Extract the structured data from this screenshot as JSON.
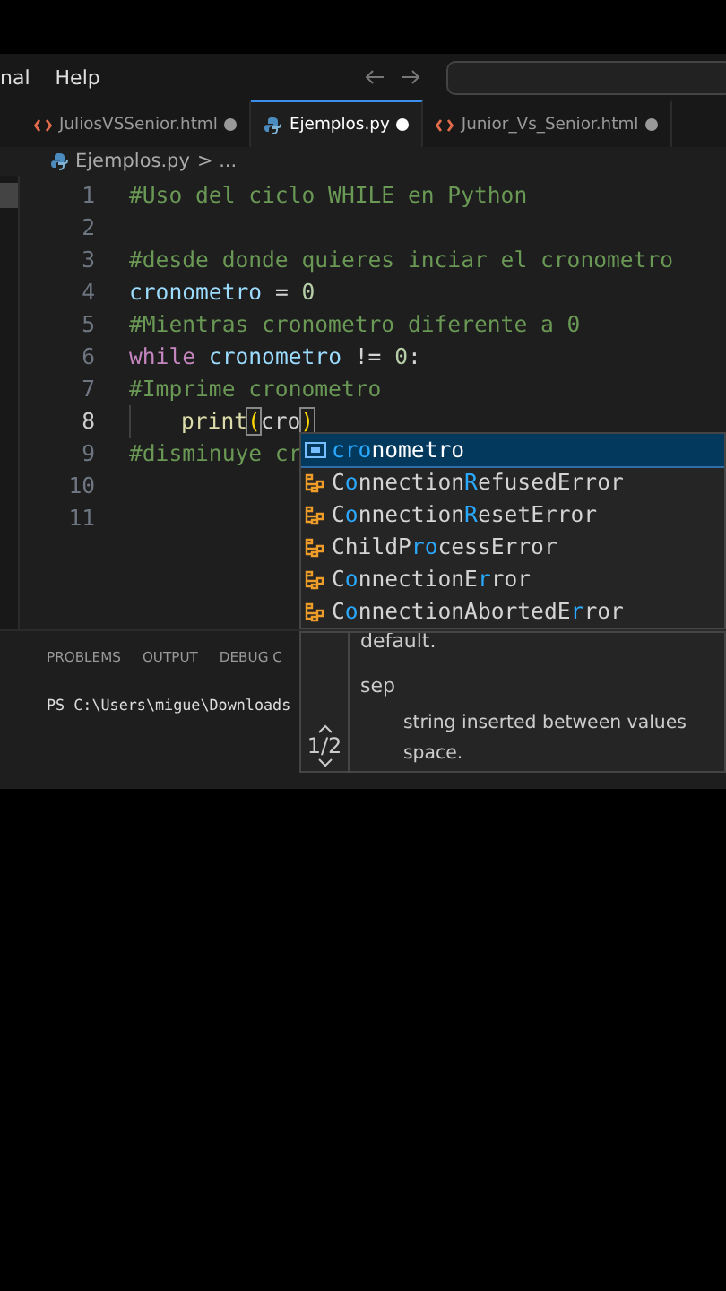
{
  "menu": [
    "nal",
    "Help"
  ],
  "tabs": [
    {
      "label": "JuliosVSSenior.html",
      "kind": "html",
      "selected": false,
      "modified": true
    },
    {
      "label": "Ejemplos.py",
      "kind": "python",
      "selected": true,
      "modified": true
    },
    {
      "label": "Junior_Vs_Senior.html",
      "kind": "html",
      "selected": false,
      "modified": true
    }
  ],
  "breadcrumb": {
    "file": "Ejemplos.py",
    "rest": "> ..."
  },
  "code": [
    {
      "number": "1",
      "current": false,
      "indent": false,
      "tokens": [
        {
          "kind": "comment",
          "text": "#Uso del ciclo WHILE en Python"
        }
      ]
    },
    {
      "number": "2",
      "current": false,
      "indent": false
    },
    {
      "number": "3",
      "current": false,
      "indent": false,
      "tokens": [
        {
          "kind": "comment",
          "text": "#desde donde quieres inciar el cronometro"
        }
      ]
    },
    {
      "number": "4",
      "current": false,
      "indent": false,
      "tokens": [
        {
          "kind": "variable",
          "text": "cronometro"
        },
        {
          "kind": "plain",
          "text": " = "
        },
        {
          "kind": "number",
          "text": "0"
        }
      ]
    },
    {
      "number": "5",
      "current": false,
      "indent": false,
      "tokens": [
        {
          "kind": "comment",
          "text": "#Mientras cronometro diferente a 0"
        }
      ]
    },
    {
      "number": "6",
      "current": false,
      "indent": false,
      "tokens": [
        {
          "kind": "keyword",
          "text": "while"
        },
        {
          "kind": "variable",
          "text": " cronometro"
        },
        {
          "kind": "plain",
          "text": " != "
        },
        {
          "kind": "number",
          "text": "0"
        },
        {
          "kind": "plain",
          "text": ":"
        }
      ]
    },
    {
      "number": "7",
      "current": false,
      "indent": false,
      "tokens": [
        {
          "kind": "comment",
          "text": "#Imprime cronometro"
        }
      ]
    },
    {
      "number": "8",
      "current": true,
      "indent": true,
      "tokens": [
        {
          "kind": "function",
          "text": "print"
        },
        {
          "kind": "bracket",
          "text": "("
        },
        {
          "kind": "plain",
          "text": "cro"
        },
        {
          "kind": "bracket",
          "text": ")"
        }
      ]
    },
    {
      "number": "9",
      "current": false,
      "indent": false,
      "tokens": [
        {
          "kind": "comment",
          "text": "#disminuye cr"
        }
      ]
    },
    {
      "number": "10",
      "current": false,
      "indent": false
    },
    {
      "number": "11",
      "current": false,
      "indent": false
    }
  ],
  "suggestions": [
    {
      "kind": "variable",
      "selected": true,
      "parts": [
        {
          "text": "cro",
          "match": true
        },
        {
          "text": "nometro",
          "match": false
        }
      ]
    },
    {
      "kind": "class",
      "selected": false,
      "parts": [
        {
          "text": "C",
          "match": false
        },
        {
          "text": "o",
          "match": true
        },
        {
          "text": "nnection",
          "match": false
        },
        {
          "text": "R",
          "match": true
        },
        {
          "text": "efusedError",
          "match": false
        }
      ]
    },
    {
      "kind": "class",
      "selected": false,
      "parts": [
        {
          "text": "C",
          "match": false
        },
        {
          "text": "o",
          "match": true
        },
        {
          "text": "nnection",
          "match": false
        },
        {
          "text": "R",
          "match": true
        },
        {
          "text": "esetError",
          "match": false
        }
      ]
    },
    {
      "kind": "class",
      "selected": false,
      "parts": [
        {
          "text": "ChildP",
          "match": false
        },
        {
          "text": "ro",
          "match": true
        },
        {
          "text": "cessError",
          "match": false
        }
      ]
    },
    {
      "kind": "class",
      "selected": false,
      "parts": [
        {
          "text": "C",
          "match": false
        },
        {
          "text": "o",
          "match": true
        },
        {
          "text": "nnectionE",
          "match": false
        },
        {
          "text": "r",
          "match": true
        },
        {
          "text": "ror",
          "match": false
        }
      ]
    },
    {
      "kind": "class",
      "selected": false,
      "parts": [
        {
          "text": "C",
          "match": false
        },
        {
          "text": "o",
          "match": true
        },
        {
          "text": "nnectionAbortedE",
          "match": false
        },
        {
          "text": "r",
          "match": true
        },
        {
          "text": "ror",
          "match": false
        }
      ]
    }
  ],
  "hover": {
    "page": "1/2",
    "lines": [
      {
        "kind": "text",
        "text": "default."
      },
      {
        "kind": "param",
        "text": "sep"
      },
      {
        "kind": "desc",
        "text": "string inserted between values"
      },
      {
        "kind": "desc",
        "text": "space."
      }
    ]
  },
  "panel": {
    "tabs": [
      "PROBLEMS",
      "OUTPUT",
      "DEBUG C"
    ],
    "terminal": "PS C:\\Users\\migue\\Downloads"
  }
}
